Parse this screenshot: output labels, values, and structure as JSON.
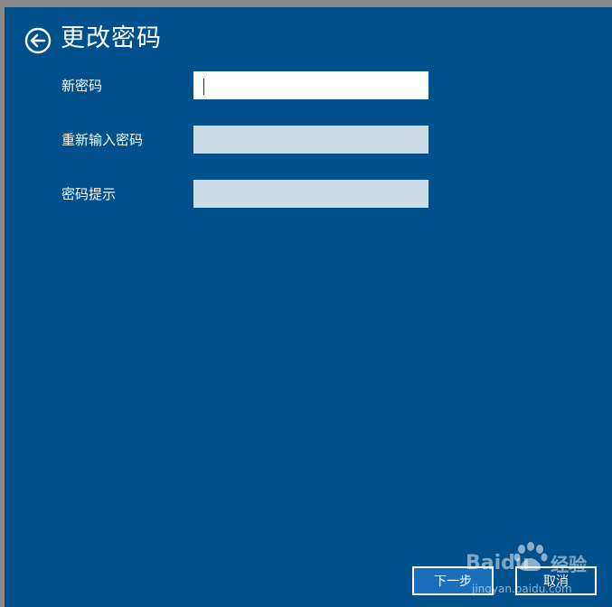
{
  "dialog": {
    "title": "更改密码"
  },
  "form": {
    "new_password": {
      "label": "新密码",
      "value": ""
    },
    "confirm_password": {
      "label": "重新输入密码",
      "value": ""
    },
    "password_hint": {
      "label": "密码提示",
      "value": ""
    }
  },
  "buttons": {
    "next": "下一步",
    "cancel": "取消"
  },
  "watermark": {
    "brand": "Baidu",
    "cn": "经验",
    "url": "jingyan.baidu.com"
  },
  "colors": {
    "panel_bg": "#00508b",
    "primary_button": "#1a6fbd",
    "inactive_input": "#cddbe6"
  },
  "icons": {
    "back": "back-arrow-circle-icon"
  }
}
